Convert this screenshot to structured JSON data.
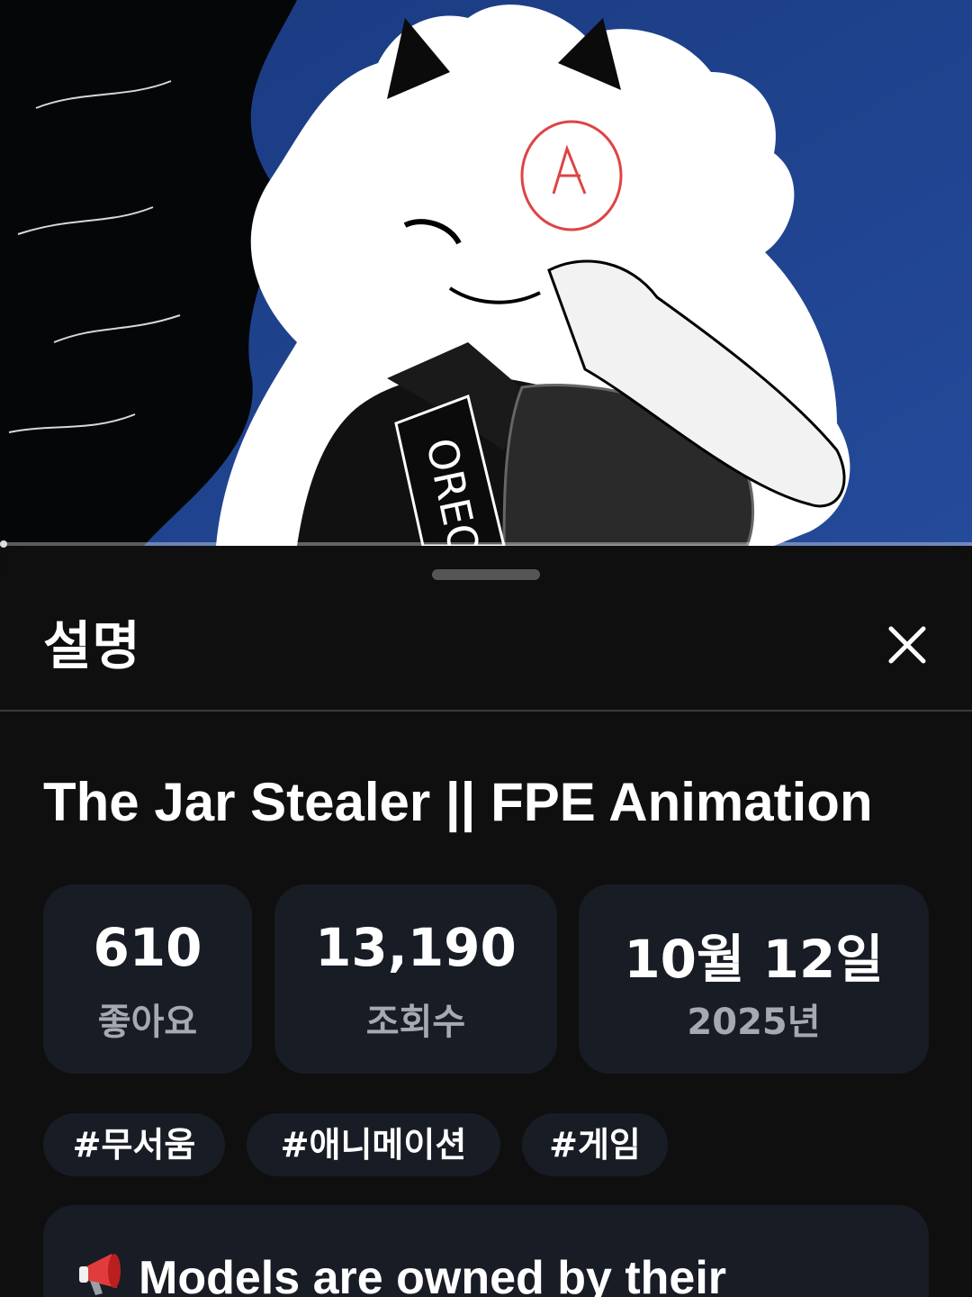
{
  "sheet": {
    "title": "설명",
    "close_icon": "close-icon"
  },
  "video": {
    "title": "The Jar Stealer || FPE Animation",
    "thumbnail_text": "OREO",
    "progress": 0.0
  },
  "stats": [
    {
      "value": "610",
      "label": "좋아요"
    },
    {
      "value": "13,190",
      "label": "조회수"
    },
    {
      "value": "10월 12일",
      "label": "2025년"
    }
  ],
  "tags": [
    "#무서움",
    "#애니메이션",
    "#게임"
  ],
  "description": {
    "icon": "megaphone-icon",
    "text": "Models are owned by their"
  },
  "colors": {
    "background": "#0f0f0f",
    "card": "#181c25",
    "muted_text": "#a6a9b0",
    "thumbnail_bg": "#1d3f8a"
  }
}
